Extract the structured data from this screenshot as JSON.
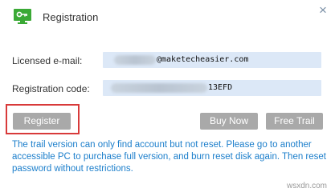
{
  "window": {
    "title": "Registration",
    "close_symbol": "×"
  },
  "form": {
    "email_label": "Licensed e-mail:",
    "email_visible": "@maketecheasier.com",
    "code_label": "Registration code:",
    "code_visible": "13EFD"
  },
  "buttons": {
    "register": "Register",
    "buy_now": "Buy Now",
    "free_trail": "Free Trail"
  },
  "note": "The trail version can only find account but not reset. Please go to another accessible PC to purchase full version, and burn reset disk again. Then reset password without restrictions.",
  "watermark": "wsxdn.com",
  "colors": {
    "accent": "#1b7ecb",
    "highlight": "#d83a3a",
    "button_bg": "#a9a9a9",
    "field_bg": "#dce8f7",
    "icon_green": "#3aa935"
  }
}
